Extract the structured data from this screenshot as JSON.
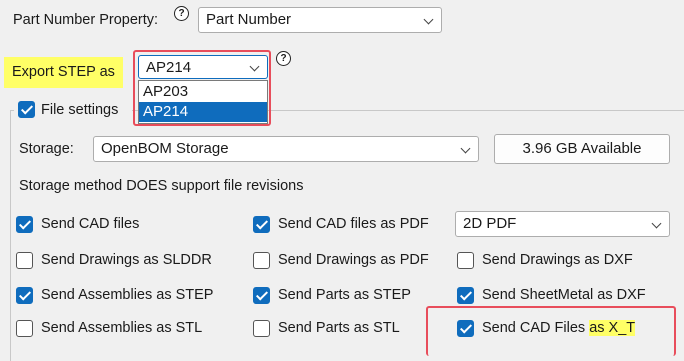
{
  "part_number": {
    "label": "Part Number Property:",
    "value": "Part Number"
  },
  "export_step": {
    "label": "Export STEP as",
    "value": "AP214",
    "options": [
      "AP203",
      "AP214"
    ],
    "selected_index": 1
  },
  "help_glyph": "?",
  "file_settings": {
    "label": "File settings",
    "checked": true
  },
  "storage": {
    "label": "Storage:",
    "value": "OpenBOM Storage",
    "available": "3.96 GB Available",
    "note": "Storage method DOES support file revisions"
  },
  "pdf_format": {
    "value": "2D PDF"
  },
  "checks": {
    "send_cad_files": {
      "label": "Send CAD files",
      "checked": true
    },
    "send_cad_files_as_pdf": {
      "label": "Send CAD files as PDF",
      "checked": true
    },
    "send_drawings_slddr": {
      "label": "Send  Drawings  as SLDDR",
      "checked": false
    },
    "send_drawings_pdf": {
      "label": "Send Drawings as PDF",
      "checked": false
    },
    "send_drawings_dxf": {
      "label": "Send Drawings as DXF",
      "checked": false
    },
    "send_assemblies_step": {
      "label": "Send Assemblies as STEP",
      "checked": true
    },
    "send_parts_step": {
      "label": "Send Parts as STEP",
      "checked": true
    },
    "send_sheetmetal_dxf": {
      "label": "Send SheetMetal as DXF",
      "checked": true
    },
    "send_assemblies_stl": {
      "label": "Send Assemblies as STL",
      "checked": false
    },
    "send_parts_stl": {
      "label": "Send Parts as STL",
      "checked": false
    },
    "send_cad_files_xt": {
      "label_a": "Send CAD Files ",
      "label_b": "as X_T",
      "checked": true
    }
  },
  "colors": {
    "accent": "#0f6cbd",
    "highlight": "#ffff66",
    "annotation_red": "#e84d5b"
  }
}
